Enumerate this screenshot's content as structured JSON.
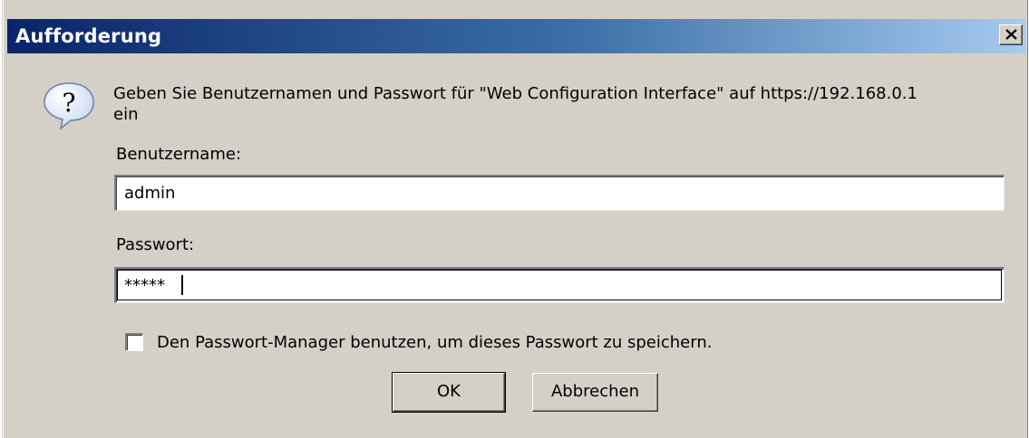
{
  "dialog": {
    "title": "Aufforderung",
    "close_glyph": "close-icon",
    "message_line1": "Geben Sie Benutzernamen und Passwort für \"Web Configuration Interface\" auf https://192.168.0.1",
    "message_line2": "ein",
    "icon": "question-icon"
  },
  "form": {
    "username_label": "Benutzername:",
    "username_value": "admin",
    "password_label": "Passwort:",
    "password_value": "*****",
    "remember_label": "Den Passwort-Manager benutzen, um dieses Passwort zu speichern.",
    "remember_checked": false
  },
  "buttons": {
    "ok_label": "OK",
    "cancel_label": "Abbrechen"
  }
}
